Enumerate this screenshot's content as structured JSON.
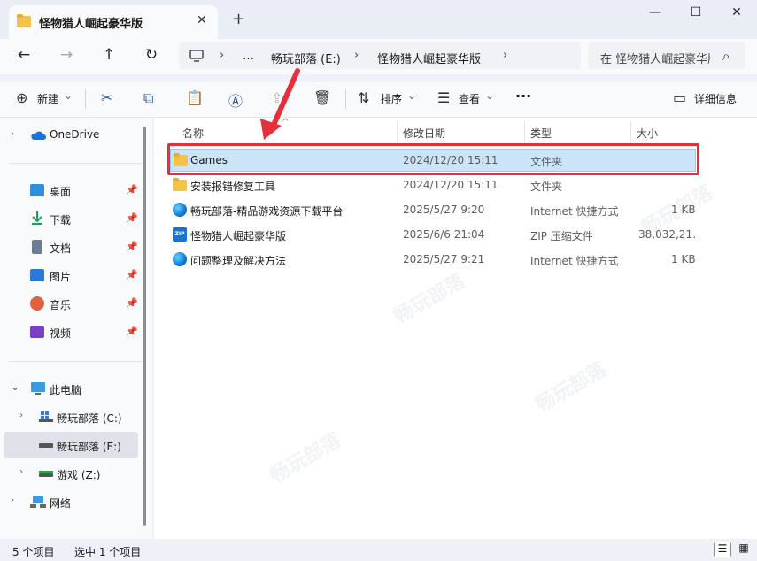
{
  "window": {
    "tab_title": "怪物猎人崛起豪华版",
    "tab_close": "✕",
    "new_tab": "+",
    "minimize": "—",
    "maximize": "☐",
    "close": "✕"
  },
  "nav": {
    "back": "←",
    "forward": "→",
    "up": "↑",
    "refresh": "↻",
    "breadcrumb": [
      "…",
      "畅玩部落 (E:)",
      "怪物猎人崛起豪华版"
    ],
    "chevron": "›",
    "search_placeholder": "在 怪物猎人崛起豪华版 中搜索",
    "search_icon": "⌕"
  },
  "toolbar": {
    "new_label": "新建",
    "sort_label": "排序",
    "view_label": "查看",
    "more_label": "···",
    "details_label": "详细信息",
    "dropdown": "⌄",
    "icons": {
      "new": "⊕",
      "cut": "✂",
      "copy": "⧉",
      "paste": "📋",
      "rename": "Ⓐ",
      "share": "⇪",
      "delete": "🗑",
      "sort": "⇅",
      "view": "☰",
      "details": "▭"
    }
  },
  "sidebar": {
    "onedrive": "OneDrive",
    "quick": [
      {
        "label": "桌面",
        "color": "#2f8fd8"
      },
      {
        "label": "下载",
        "color": "#1b9e5a"
      },
      {
        "label": "文档",
        "color": "#6b7c93"
      },
      {
        "label": "图片",
        "color": "#2a7bd6"
      },
      {
        "label": "音乐",
        "color": "#e0613a"
      },
      {
        "label": "视频",
        "color": "#7a3fc2"
      }
    ],
    "pin": "📌",
    "this_pc": "此电脑",
    "drives": [
      {
        "label": "畅玩部落 (C:)",
        "selected": false
      },
      {
        "label": "畅玩部落 (E:)",
        "selected": true
      },
      {
        "label": "游戏 (Z:)",
        "selected": false
      }
    ],
    "network": "网络",
    "chev_right": "›",
    "chev_down": "⌄"
  },
  "list": {
    "columns": [
      "名称",
      "修改日期",
      "类型",
      "大小"
    ],
    "sort_indicator": "^",
    "rows": [
      {
        "name": "Games",
        "date": "2024/12/20 15:11",
        "type": "文件夹",
        "size": "",
        "icon": "folder",
        "selected": true
      },
      {
        "name": "安装报错修复工具",
        "date": "2024/12/20 15:11",
        "type": "文件夹",
        "size": "",
        "icon": "folder",
        "selected": false
      },
      {
        "name": "畅玩部落-精品游戏资源下载平台",
        "date": "2025/5/27 9:20",
        "type": "Internet 快捷方式",
        "size": "1 KB",
        "icon": "internet",
        "selected": false
      },
      {
        "name": "怪物猎人崛起豪华版",
        "date": "2025/6/6 21:04",
        "type": "ZIP 压缩文件",
        "size": "38,032,21…",
        "icon": "zip",
        "selected": false
      },
      {
        "name": "问题整理及解决方法",
        "date": "2025/5/27 9:21",
        "type": "Internet 快捷方式",
        "size": "1 KB",
        "icon": "internet",
        "selected": false
      }
    ],
    "zip_text": "ZIP"
  },
  "status": {
    "count": "5 个项目",
    "selected": "选中 1 个项目",
    "view_details": "☰",
    "view_tiles": "▦"
  },
  "colors": {
    "highlight": "#e4303c",
    "selection": "#cce4f7",
    "folder": "#f3c24b"
  }
}
